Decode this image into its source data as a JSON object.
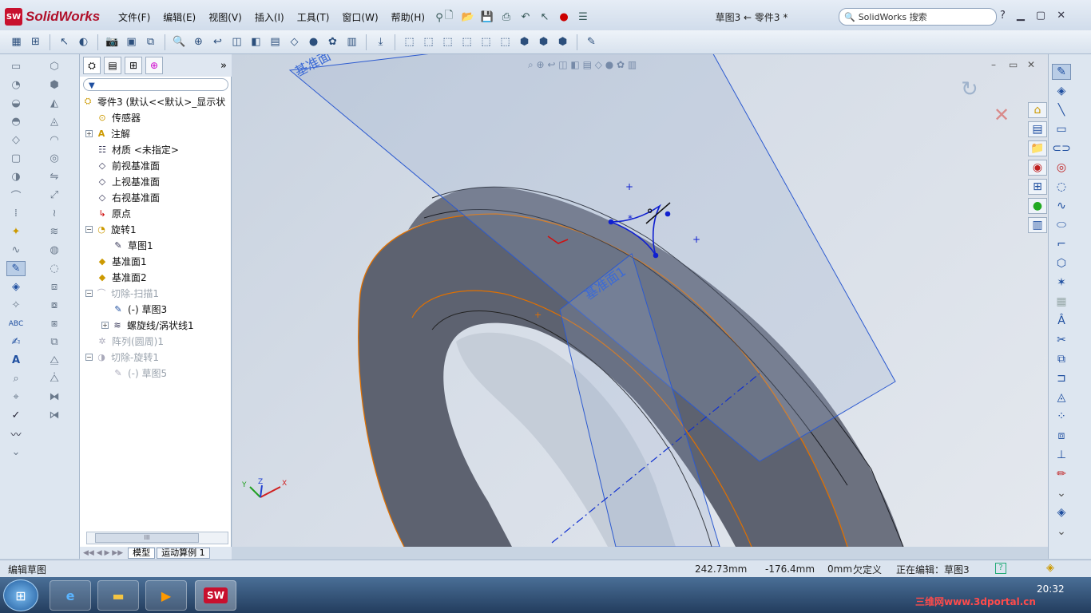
{
  "app": {
    "logo_text": "SolidWorks",
    "logo_badge": "SW"
  },
  "menu": [
    "文件(F)",
    "编辑(E)",
    "视图(V)",
    "插入(I)",
    "工具(T)",
    "窗口(W)",
    "帮助(H)"
  ],
  "doc_title": "草图3 ← 零件3 *",
  "search": {
    "placeholder": "SolidWorks 搜索"
  },
  "panel": {
    "root": "零件3  (默认<<默认>_显示状",
    "items": [
      {
        "label": "传感器"
      },
      {
        "label": "注解"
      },
      {
        "label": "材质 <未指定>"
      },
      {
        "label": "前视基准面"
      },
      {
        "label": "上视基准面"
      },
      {
        "label": "右视基准面"
      },
      {
        "label": "原点"
      },
      {
        "label": "旋转1"
      },
      {
        "label": "草图1"
      },
      {
        "label": "基准面1"
      },
      {
        "label": "基准面2"
      },
      {
        "label": "切除-扫描1"
      },
      {
        "label": "(-) 草图3"
      },
      {
        "label": "螺旋线/涡状线1"
      },
      {
        "label": "阵列(圆周)1"
      },
      {
        "label": "切除-旋转1"
      },
      {
        "label": "(-) 草图5"
      }
    ],
    "tabs": [
      "模型",
      "运动算例 1"
    ],
    "scroll_label": "III"
  },
  "viewport": {
    "plane_label_1": "基准面1",
    "plane_label_top": "基准面"
  },
  "status": {
    "mode": "编辑草图",
    "x": "242.73mm",
    "y": "-176.4mm",
    "z": "0mm",
    "state": "欠定义",
    "editing": "正在编辑：草图3"
  },
  "taskbar": {
    "time": "20:32",
    "watermark": "三维网www.3dportal.cn"
  },
  "colors": {
    "accent": "#1f4fa0",
    "sketch_blue": "#1020d0",
    "edge_orange": "#e07000",
    "model": "#5d6270"
  }
}
